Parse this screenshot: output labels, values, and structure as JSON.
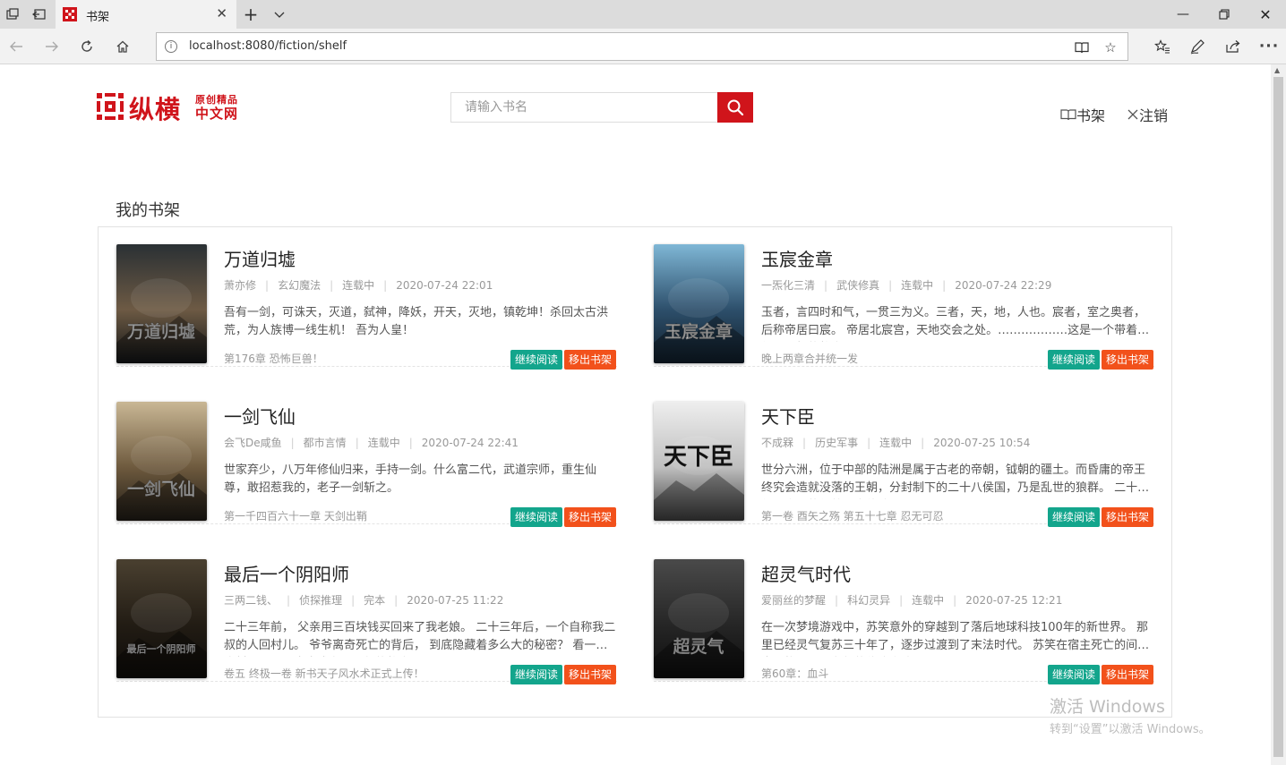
{
  "browser": {
    "tab_title": "书架",
    "url": "localhost:8080/fiction/shelf"
  },
  "header": {
    "logo_text": "纵横",
    "logo_sub1": "原创精品",
    "logo_sub2": "中文网",
    "search_placeholder": "请输入书名",
    "link_shelf": "书架",
    "link_logout": "注销"
  },
  "shelf": {
    "title": "我的书架",
    "books": [
      {
        "title": "万道归墟",
        "author": "萧亦修",
        "category": "玄幻魔法",
        "status": "连载中",
        "updated": "2020-07-24 22:01",
        "desc": "吾有一剑，可诛天，灭道，弑神，降妖，开天，灭地，镇乾坤！杀回太古洪荒，为人族博一线生机！ 吾为人皇！",
        "latest": "第176章 恐怖巨兽！",
        "read_label": "继续阅读",
        "remove_label": "移出书架",
        "cover_text": "万道归墟",
        "cover_colors": [
          "#2a3034",
          "#6d5a44",
          "#101315"
        ]
      },
      {
        "title": "玉宸金章",
        "author": "一炁化三清",
        "category": "武侠修真",
        "status": "连载中",
        "updated": "2020-07-24 22:29",
        "desc": "玉者，言四时和气，一贯三为义。三者，天，地，人也。宸者，室之奥者，后称帝居曰宸。 帝居北宸宫，天地交会之处。………………这是一个带着修仙与不朽的故事。",
        "latest": "晚上两章合并统一发",
        "read_label": "继续阅读",
        "remove_label": "移出书架",
        "cover_text": "玉宸金章",
        "cover_colors": [
          "#7fb7d6",
          "#2d4f6b",
          "#0f1c28"
        ]
      },
      {
        "title": "一剑飞仙",
        "author": "会飞De咸鱼",
        "category": "都市言情",
        "status": "连载中",
        "updated": "2020-07-24 22:41",
        "desc": "世家弃少，八万年修仙归来，手持一剑。什么富二代，武道宗师，重生仙尊，敢招惹我的，老子一剑斩之。",
        "latest": "第一千四百六十一章 天剑出鞘",
        "read_label": "继续阅读",
        "remove_label": "移出书架",
        "cover_text": "一剑飞仙",
        "cover_colors": [
          "#c9b795",
          "#6e5a3e",
          "#1e1a15"
        ]
      },
      {
        "title": "天下臣",
        "author": "不成槑",
        "category": "历史军事",
        "status": "连载中",
        "updated": "2020-07-25 10:54",
        "desc": "世分六洲，位于中部的陆洲是属于古老的帝朝，钺朝的疆土。而昏庸的帝王终究会造就没落的王朝，分封制下的二十八侯国，乃是乱世的狼群。 二十八侯国之间的征战从未停歇。",
        "latest": "第一卷 酉矢之殇 第五十七章 忍无可忍",
        "read_label": "继续阅读",
        "remove_label": "移出书架",
        "cover_text": "天下臣",
        "cover_colors": [
          "#eeeeee",
          "#bfbfbf",
          "#3b3b3b"
        ]
      },
      {
        "title": "最后一个阴阳师",
        "author": "三两二钱、",
        "category": "侦探推理",
        "status": "完本",
        "updated": "2020-07-25 11:22",
        "desc": "二十三年前， 父亲用三百块钱买回来了我老娘。 二十三年后，一个自称我二叔的人回村儿。 爷爷离奇死亡的背后， 到底隐藏着多么大的秘密？ 看一个农村小伙子一步步成为阴阳师的故事。",
        "latest": "卷五 终极一卷 新书天子风水术正式上传！",
        "read_label": "继续阅读",
        "remove_label": "移出书架",
        "cover_text": "最后一个阴阳师",
        "cover_colors": [
          "#4a4030",
          "#221c14",
          "#0d0b08"
        ]
      },
      {
        "title": "超灵气时代",
        "author": "爱丽丝的梦醒",
        "category": "科幻灵异",
        "status": "连载中",
        "updated": "2020-07-25 12:21",
        "desc": "在一次梦境游戏中，苏笑意外的穿越到了落后地球科技100年的新世界。 那里已经灵气复苏三十年了，逐步过渡到了末法时代。 苏笑在宿主死亡的间隙中，找到了一条新的修炼之路。",
        "latest": "第60章：血斗",
        "read_label": "继续阅读",
        "remove_label": "移出书架",
        "cover_text": "超灵气",
        "cover_colors": [
          "#4a4a4a",
          "#262626",
          "#0c0c0c"
        ]
      }
    ]
  },
  "watermark": {
    "line1": "激活 Windows",
    "line2": "转到“设置”以激活 Windows。"
  }
}
